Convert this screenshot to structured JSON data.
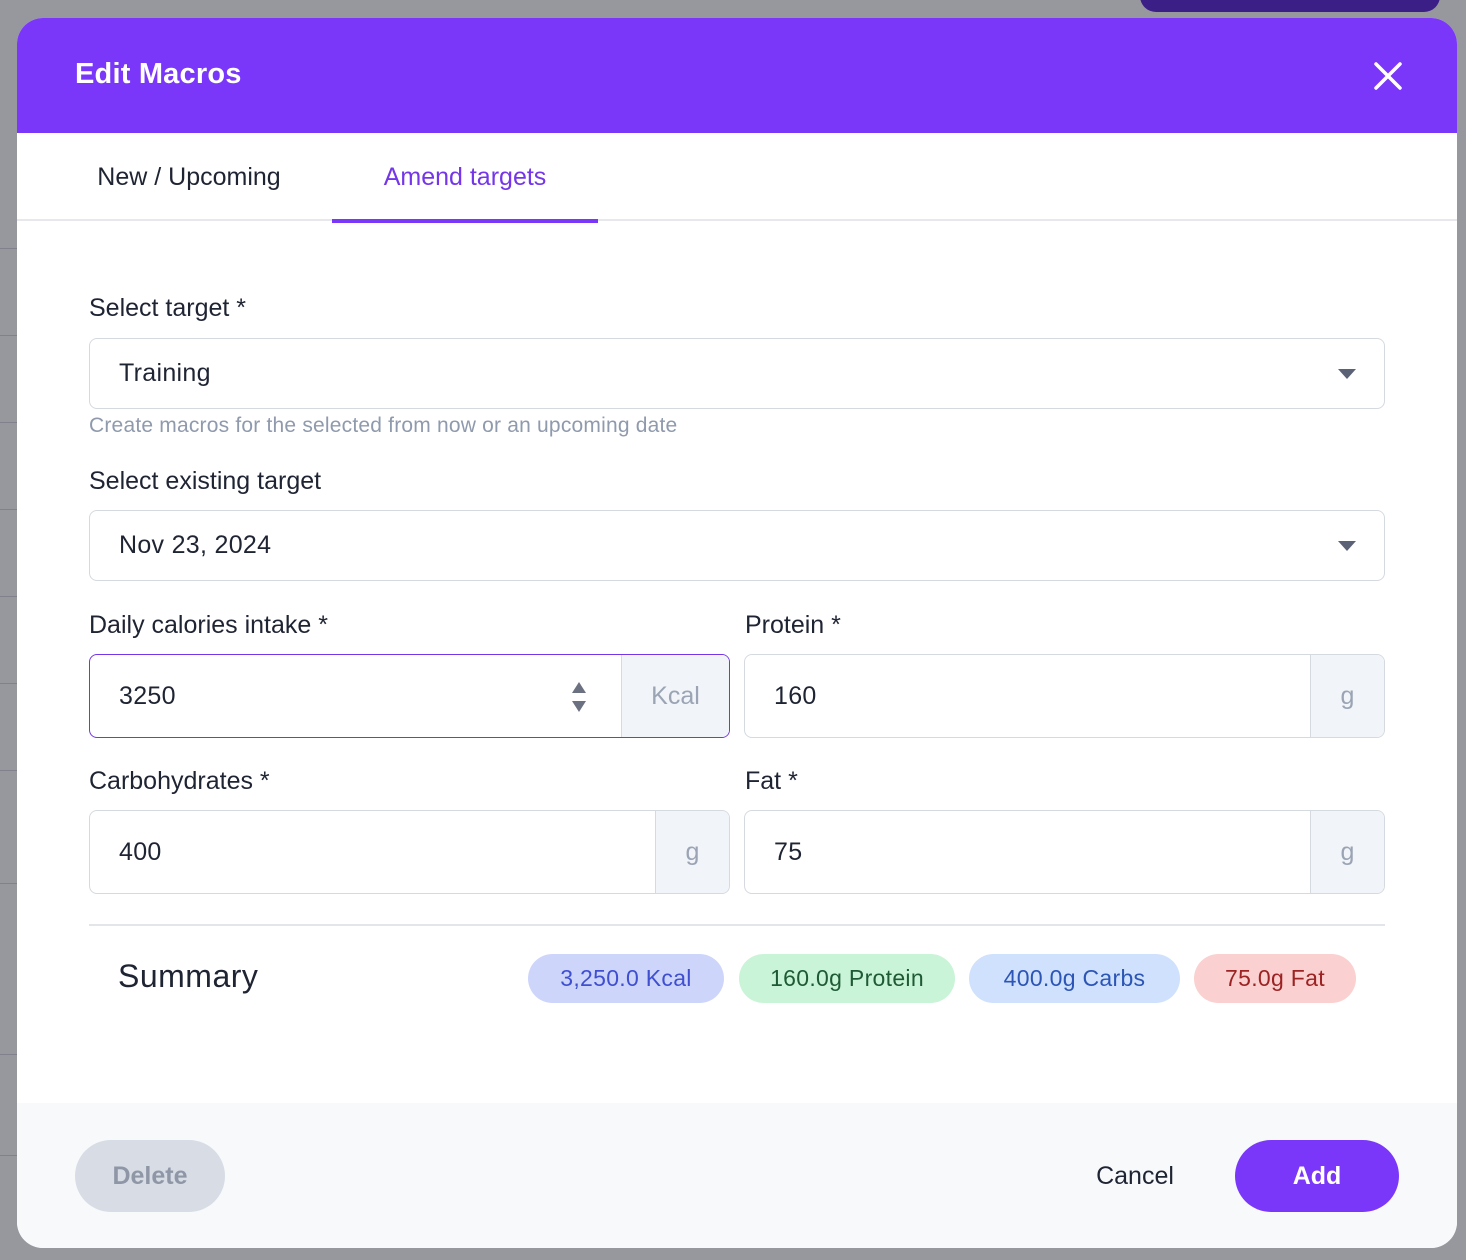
{
  "modal": {
    "title": "Edit Macros"
  },
  "tabs": [
    {
      "label": "New / Upcoming",
      "active": false
    },
    {
      "label": "Amend targets",
      "active": true
    }
  ],
  "form": {
    "select_target": {
      "label": "Select target *",
      "value": "Training",
      "help": "Create macros for the selected from now or an upcoming date"
    },
    "existing_target": {
      "label": "Select existing target",
      "value": "Nov 23, 2024"
    },
    "calories": {
      "label": "Daily calories intake *",
      "value": "3250",
      "unit": "Kcal"
    },
    "protein": {
      "label": "Protein *",
      "value": "160",
      "unit": "g"
    },
    "carbs": {
      "label": "Carbohydrates *",
      "value": "400",
      "unit": "g"
    },
    "fat": {
      "label": "Fat *",
      "value": "75",
      "unit": "g"
    }
  },
  "summary": {
    "title": "Summary",
    "badges": [
      {
        "text": "3,250.0 Kcal",
        "bg": "#cdd5fb",
        "fg": "#3f4fd0"
      },
      {
        "text": "160.0g Protein",
        "bg": "#c9f4d7",
        "fg": "#1f5a35"
      },
      {
        "text": "400.0g Carbs",
        "bg": "#cfe1fd",
        "fg": "#2c55b5"
      },
      {
        "text": "75.0g Fat",
        "bg": "#fbd0d0",
        "fg": "#9c2323"
      }
    ]
  },
  "footer": {
    "delete_label": "Delete",
    "cancel_label": "Cancel",
    "add_label": "Add"
  },
  "colors": {
    "accent": "#7a37fa",
    "active_tab_text": "#7436e8"
  }
}
